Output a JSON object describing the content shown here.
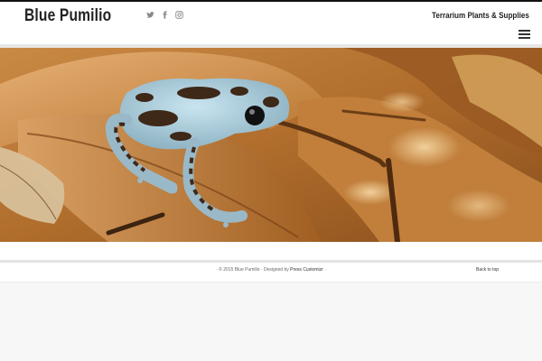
{
  "header": {
    "site_title": "Blue Pumilio",
    "tagline": "Terrarium Plants & Supplies",
    "social_icons": [
      "twitter-icon",
      "facebook-icon",
      "instagram-icon"
    ],
    "menu_icon": "hamburger-menu-icon"
  },
  "hero": {
    "image_subject": "frog"
  },
  "footer": {
    "copyright": "· © 2015 Blue Pumilio · Designed by",
    "designer_link": "Press Customizr",
    "copyright_end": " ·",
    "back_to_top": "Back to top"
  },
  "colors": {
    "header_bg": "#ffffff",
    "page_bg": "#f7f7f7",
    "title_color": "#222222"
  }
}
